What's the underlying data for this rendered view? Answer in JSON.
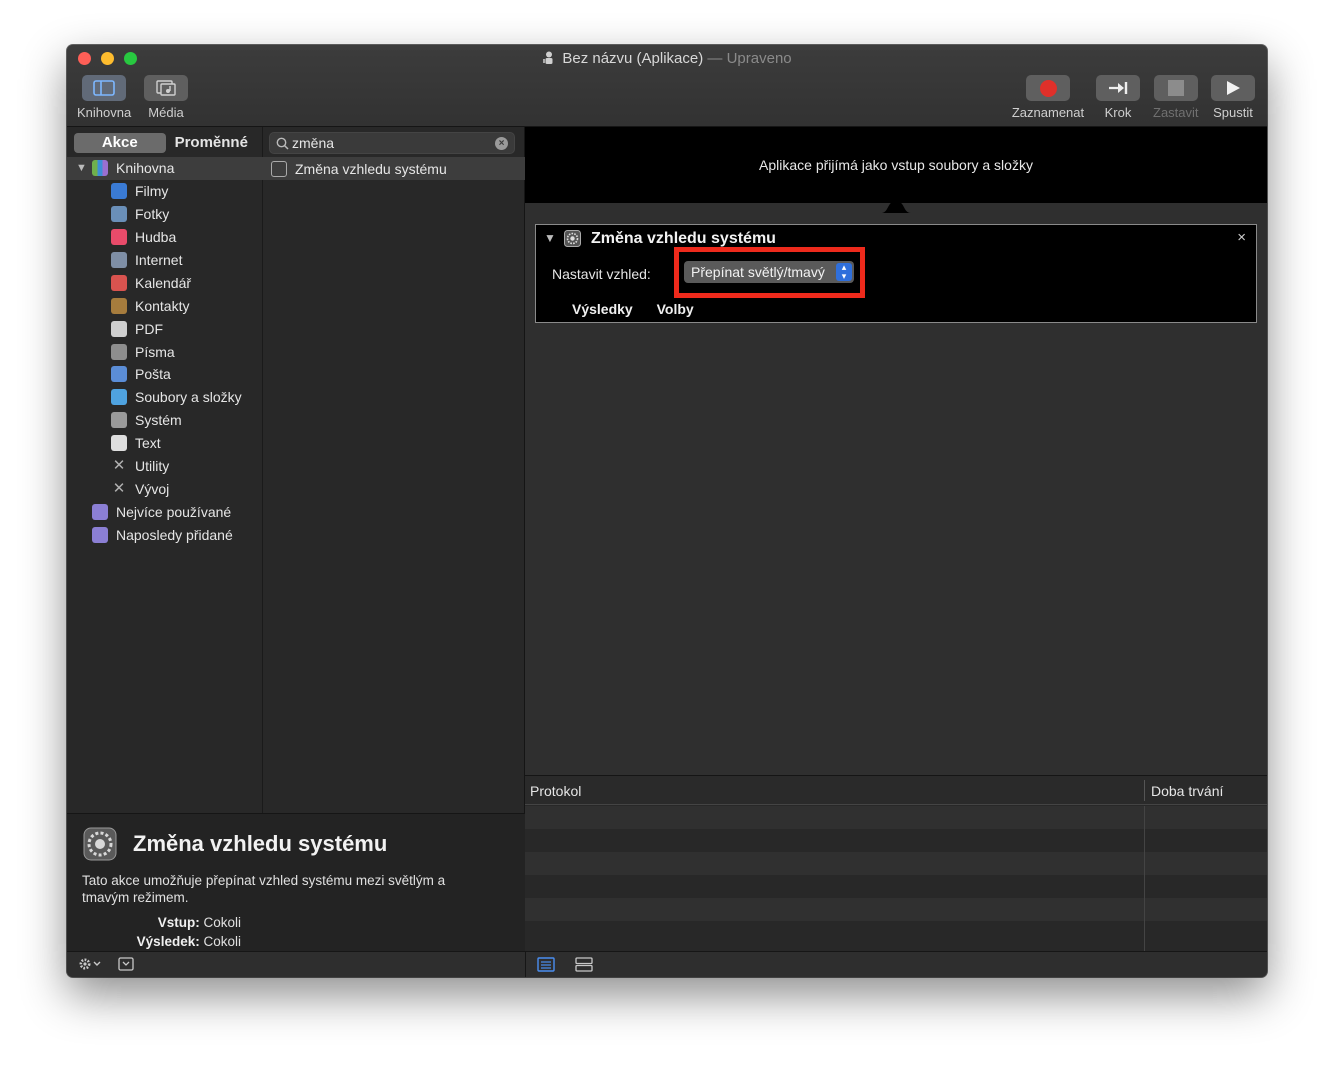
{
  "window": {
    "title": "Bez názvu (Aplikace)",
    "title_status": "— Upraveno"
  },
  "toolbar": {
    "library_label": "Knihovna",
    "media_label": "Média",
    "record_label": "Zaznamenat",
    "step_label": "Krok",
    "stop_label": "Zastavit",
    "run_label": "Spustit"
  },
  "tabs": {
    "actions": "Akce",
    "variables": "Proměnné"
  },
  "search": {
    "value": "změna"
  },
  "library": {
    "root": "Knihovna",
    "items": [
      {
        "label": "Filmy",
        "icon": "films-icon",
        "color": "#3a7bd5"
      },
      {
        "label": "Fotky",
        "icon": "photos-icon",
        "color": "#6a8fb8"
      },
      {
        "label": "Hudba",
        "icon": "music-icon",
        "color": "#e94b6a"
      },
      {
        "label": "Internet",
        "icon": "internet-icon",
        "color": "#7f8fa6"
      },
      {
        "label": "Kalendář",
        "icon": "calendar-icon",
        "color": "#d9534f"
      },
      {
        "label": "Kontakty",
        "icon": "contacts-icon",
        "color": "#a67c3d"
      },
      {
        "label": "PDF",
        "icon": "pdf-icon",
        "color": "#cfcfcf"
      },
      {
        "label": "Písma",
        "icon": "fonts-icon",
        "color": "#8e8e8e"
      },
      {
        "label": "Pošta",
        "icon": "mail-icon",
        "color": "#5b8dd6"
      },
      {
        "label": "Soubory a složky",
        "icon": "finder-icon",
        "color": "#4fa3e0"
      },
      {
        "label": "Systém",
        "icon": "system-icon",
        "color": "#9a9a9a"
      },
      {
        "label": "Text",
        "icon": "text-icon",
        "color": "#dedede"
      },
      {
        "label": "Utility",
        "icon": "utility-icon",
        "color": "#b0b0b0"
      },
      {
        "label": "Vývoj",
        "icon": "developer-icon",
        "color": "#b0b0b0"
      }
    ],
    "smart_groups": [
      {
        "label": "Nejvíce používané",
        "icon": "smart-folder-icon",
        "color": "#8b7fd4"
      },
      {
        "label": "Naposledy přidané",
        "icon": "smart-folder-icon",
        "color": "#8b7fd4"
      }
    ]
  },
  "results": {
    "item": "Změna vzhledu systému"
  },
  "description": {
    "title": "Změna vzhledu systému",
    "text": "Tato akce umožňuje přepínat vzhled systému mezi světlým a tmavým režimem.",
    "input_label": "Vstup:",
    "input_value": "Cokoli",
    "output_label": "Výsledek:",
    "output_value": "Cokoli"
  },
  "workflow": {
    "header": "Aplikace přijímá jako vstup soubory a složky",
    "action": {
      "name": "Změna vzhledu systému",
      "field_label": "Nastavit vzhled:",
      "popup_value": "Přepínat světlý/tmavý",
      "tab_results": "Výsledky",
      "tab_options": "Volby",
      "close": "×"
    }
  },
  "log": {
    "col_protocol": "Protokol",
    "col_duration": "Doba trvání"
  },
  "colors": {
    "highlight": "#ee2a1c",
    "accent": "#2f6fdb"
  }
}
